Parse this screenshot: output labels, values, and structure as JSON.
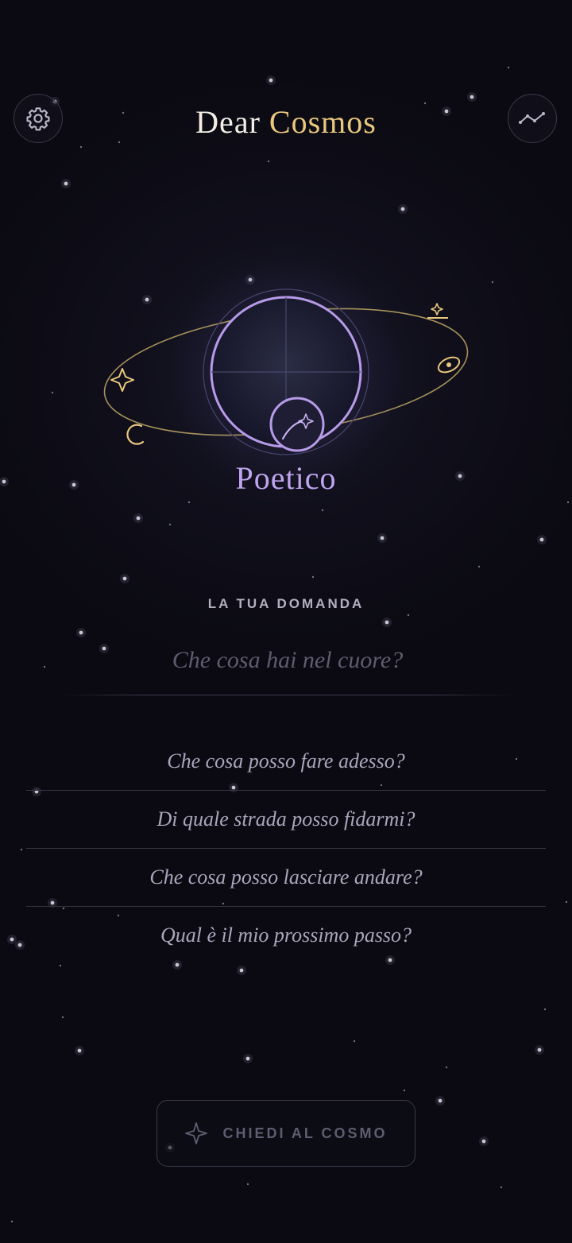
{
  "header": {
    "title_primary": "Dear",
    "title_accent": "Cosmos",
    "settings_icon": "gear-icon",
    "stats_icon": "line-chart-icon"
  },
  "mode": {
    "label": "Poetico",
    "icon": "shooting-star-icon"
  },
  "question": {
    "section_label": "LA TUA DOMANDA",
    "value": "",
    "placeholder": "Che cosa hai nel cuore?"
  },
  "suggestions": [
    "Che cosa posso fare adesso?",
    "Di quale strada posso fidarmi?",
    "Che cosa posso lasciare andare?",
    "Qual è il mio prossimo passo?"
  ],
  "cta": {
    "label": "CHIEDI AL COSMO",
    "icon": "sparkle-icon"
  },
  "colors": {
    "background": "#0b0a12",
    "accent_gold": "#e8c77e",
    "accent_lavender": "#bfa5f0",
    "text_muted": "#aaa7bd"
  }
}
